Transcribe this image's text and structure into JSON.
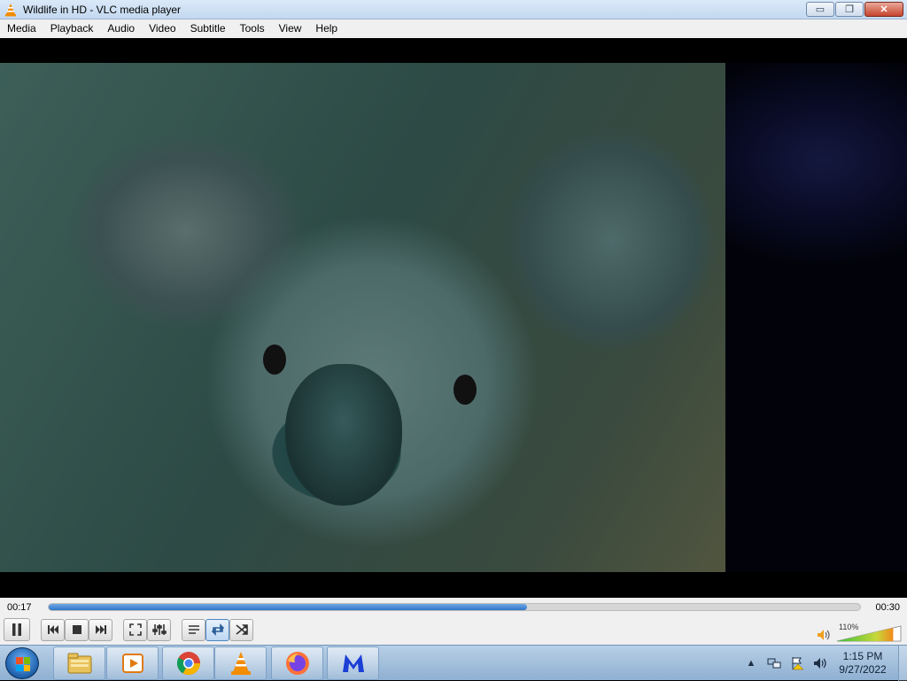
{
  "window": {
    "title": "Wildlife in HD - VLC media player",
    "buttons": {
      "minimize": "▭",
      "restore": "❐",
      "close": "✕"
    }
  },
  "menubar": {
    "items": [
      "Media",
      "Playback",
      "Audio",
      "Video",
      "Subtitle",
      "Tools",
      "View",
      "Help"
    ]
  },
  "player": {
    "current_time": "00:17",
    "total_time": "00:30",
    "progress_fraction": 0.59,
    "volume_label": "110%",
    "volume_fraction": 0.88,
    "controls": [
      "pause-icon",
      "previous-icon",
      "stop-icon",
      "next-icon",
      "fullscreen-icon",
      "extended-settings-icon",
      "playlist-icon",
      "loop-icon",
      "shuffle-icon"
    ]
  },
  "taskbar": {
    "apps": [
      "windows-explorer-icon",
      "media-player-icon",
      "chrome-icon",
      "vlc-icon",
      "firefox-icon",
      "malwarebytes-icon"
    ],
    "clock_time": "1:15 PM",
    "clock_date": "9/27/2022"
  },
  "colors": {
    "accent": "#2f75c9",
    "vlc_orange": "#f28c00",
    "close_red": "#c6432d"
  }
}
